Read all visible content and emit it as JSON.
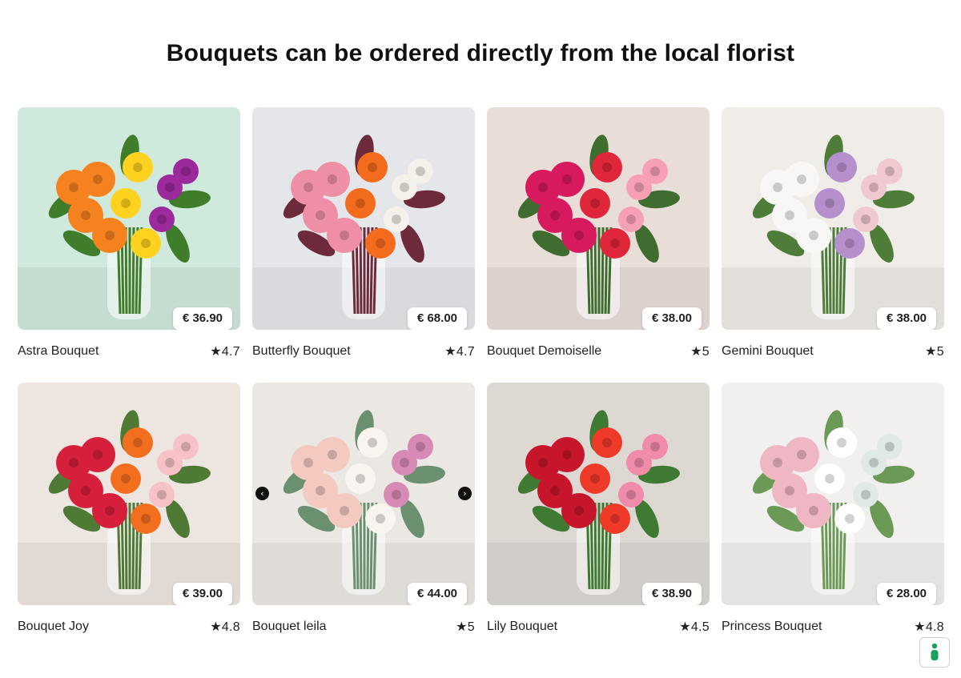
{
  "title": "Bouquets can be ordered directly from the local florist",
  "rating_star": "★",
  "products": [
    {
      "name": "Astra Bouquet",
      "price": "€ 36.90",
      "rating": "★4.7",
      "colors": [
        "#cfe9dc",
        "#f5821f",
        "#ffd21f",
        "#9c2a9c",
        "#3f7d2a"
      ]
    },
    {
      "name": "Butterfly Bouquet",
      "price": "€ 68.00",
      "rating": "★4.7",
      "colors": [
        "#e4e6ea",
        "#ef8fa6",
        "#f36b1c",
        "#f4f1ea",
        "#6d2a3a"
      ]
    },
    {
      "name": "Bouquet Demoiselle",
      "price": "€ 38.00",
      "rating": "★5",
      "colors": [
        "#e9ddd8",
        "#d7195e",
        "#e0263a",
        "#f6a0b5",
        "#3f6d2f"
      ]
    },
    {
      "name": "Gemini Bouquet",
      "price": "€ 38.00",
      "rating": "★5",
      "colors": [
        "#f0ece8",
        "#f7f7f5",
        "#b690cc",
        "#f0c9cf",
        "#4e7d3a"
      ]
    },
    {
      "name": "Bouquet Joy",
      "price": "€ 39.00",
      "rating": "★4.8",
      "colors": [
        "#ece5e0",
        "#d61f3b",
        "#f36f1f",
        "#f6c2c8",
        "#4f7a35"
      ]
    },
    {
      "name": "Bouquet leila",
      "price": "€ 44.00",
      "rating": "★5",
      "colors": [
        "#ebe7e3",
        "#f3c9c0",
        "#f8f4ee",
        "#d78ab5",
        "#6a9070"
      ]
    },
    {
      "name": "Lily Bouquet",
      "price": "€ 38.90",
      "rating": "★4.5",
      "colors": [
        "#ded8d3",
        "#c7162c",
        "#ef3a2a",
        "#f08caa",
        "#3f7a33"
      ]
    },
    {
      "name": "Princess Bouquet",
      "price": "€ 28.00",
      "rating": "★4.8",
      "colors": [
        "#f2f0ee",
        "#efb6c4",
        "#ffffff",
        "#dfe9e6",
        "#6a9a55"
      ]
    }
  ],
  "carousel": {
    "prev_icon": "chevron-left-icon",
    "next_icon": "chevron-right-icon",
    "prev_glyph": "‹",
    "next_glyph": "›"
  },
  "accessibility": {
    "icon": "accessibility-icon",
    "color": "#19a05a"
  }
}
